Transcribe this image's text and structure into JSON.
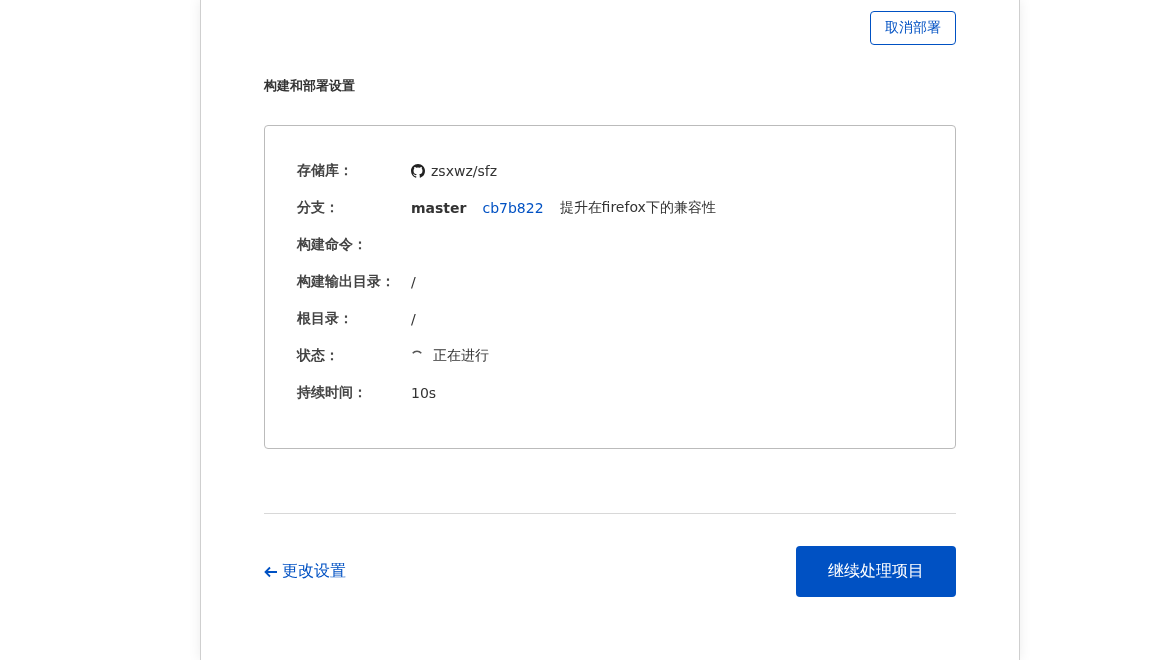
{
  "cancel_button": "取消部署",
  "section_title": "构建和部署设置",
  "details": [
    {
      "kind": "repo",
      "label": "存储库：",
      "value": "zsxwz/sfz"
    },
    {
      "kind": "branch",
      "label": "分支：",
      "branch": "master",
      "commit": "cb7b822",
      "message": "提升在firefox下的兼容性"
    },
    {
      "kind": "text",
      "label": "构建命令："
    },
    {
      "kind": "text",
      "label": "构建输出目录：",
      "value": "/"
    },
    {
      "kind": "text",
      "label": "根目录：",
      "value": "/"
    },
    {
      "kind": "status",
      "label": "状态：",
      "value": "正在进行"
    },
    {
      "kind": "text",
      "label": "持续时间：",
      "value": "10s"
    }
  ],
  "back_link": "更改设置",
  "continue_button": "继续处理项目"
}
